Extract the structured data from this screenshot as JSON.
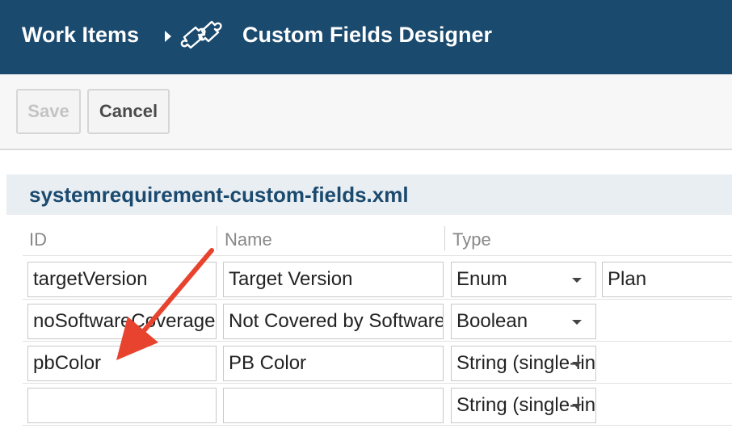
{
  "header": {
    "root": "Work Items",
    "page_title": "Custom Fields Designer",
    "bg_color": "#1b4a6f"
  },
  "toolbar": {
    "save_label": "Save",
    "cancel_label": "Cancel"
  },
  "file": {
    "title": "systemrequirement-custom-fields.xml"
  },
  "columns": {
    "id": "ID",
    "name": "Name",
    "type": "Type"
  },
  "rows": [
    {
      "id": "targetVersion",
      "name": "Target Version",
      "type": "Enum",
      "extra": "Plan"
    },
    {
      "id": "noSoftwareCoverage",
      "name": "Not Covered by Software",
      "type": "Boolean"
    },
    {
      "id": "pbColor",
      "name": "PB Color",
      "type": "String (single-line)"
    },
    {
      "id": "",
      "name": "",
      "type": "String (single-line)"
    }
  ],
  "annotation": {
    "arrow_color": "#e8432e"
  }
}
